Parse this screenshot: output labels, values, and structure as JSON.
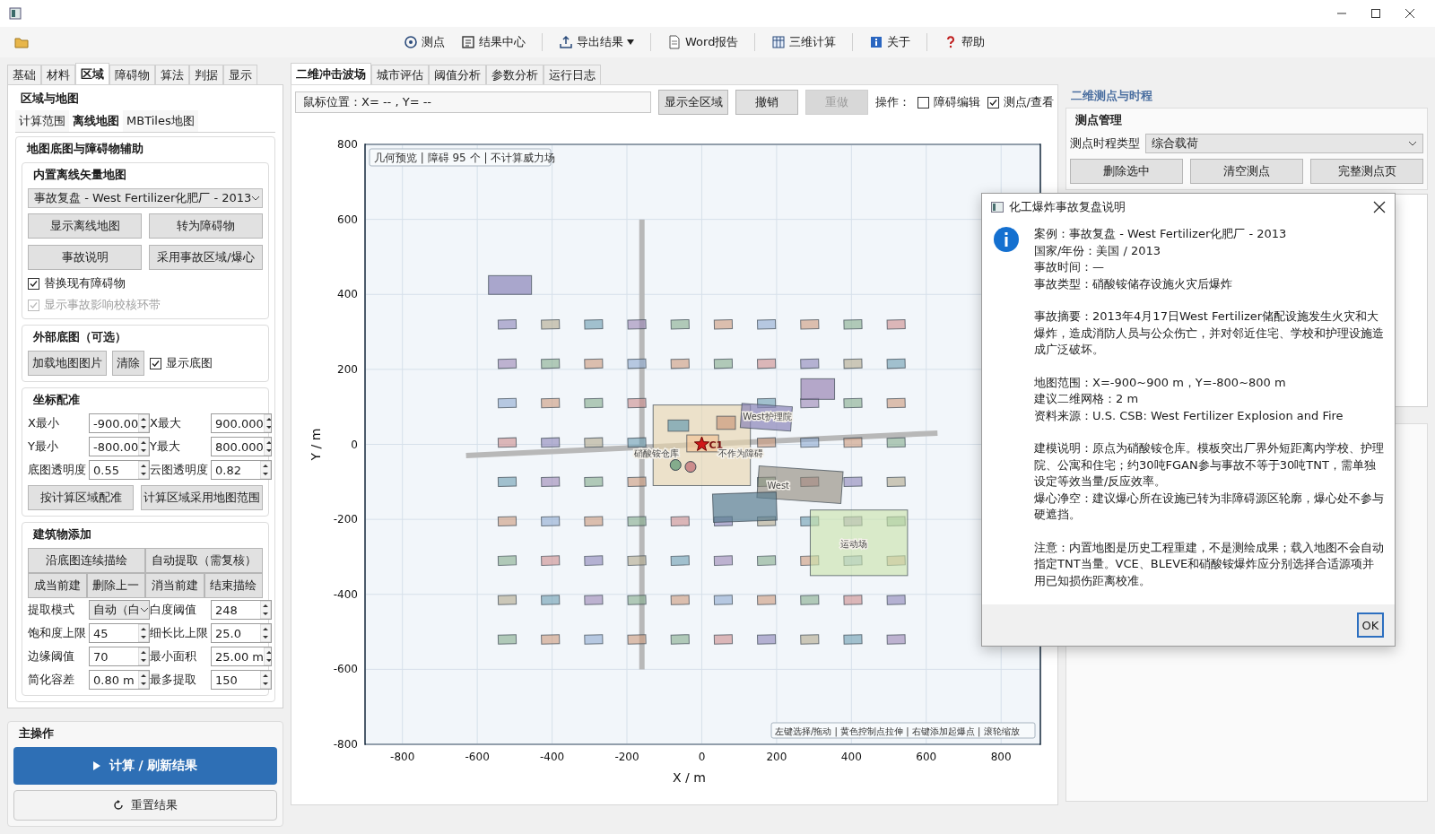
{
  "toolbar": [
    {
      "kind": "probe",
      "label": "测点",
      "menu": false
    },
    {
      "kind": "results",
      "label": "结果中心",
      "menu": false
    },
    {
      "kind": "export",
      "label": "导出结果",
      "menu": true
    },
    {
      "kind": "document",
      "label": "Word报告",
      "menu": false
    },
    {
      "kind": "grid3d",
      "label": "三维计算",
      "menu": false
    },
    {
      "kind": "about",
      "label": "关于",
      "menu": false
    },
    {
      "kind": "help",
      "label": "帮助",
      "menu": false
    }
  ],
  "left_tabs": [
    {
      "label": "基础",
      "selected": false
    },
    {
      "label": "材料",
      "selected": false
    },
    {
      "label": "区域",
      "selected": true
    },
    {
      "label": "障碍物",
      "selected": false
    },
    {
      "label": "算法",
      "selected": false
    },
    {
      "label": "判据",
      "selected": false
    },
    {
      "label": "显示",
      "selected": false
    }
  ],
  "region": {
    "title": "区域与地图",
    "tabs": [
      {
        "label": "计算范围",
        "selected": false
      },
      {
        "label": "离线地图",
        "selected": true
      },
      {
        "label": "MBTiles地图",
        "selected": false
      }
    ],
    "group_title": "地图底图与障碍物辅助",
    "offline_map": {
      "title": "内置离线矢量地图",
      "combo": "事故复盘 - West Fertilizer化肥厂 - 2013",
      "buttons": [
        "显示离线地图",
        "转为障碍物",
        "事故说明",
        "采用事故区域/爆心"
      ],
      "checks": [
        {
          "label": "替换现有障碍物",
          "checked": true,
          "disabled": false
        },
        {
          "label": "显示事故影响校核环带",
          "checked": true,
          "disabled": true
        }
      ]
    },
    "external": {
      "title": "外部底图（可选）",
      "buttons": [
        "加载地图图片",
        "清除"
      ],
      "check": {
        "label": "显示底图",
        "checked": true,
        "disabled": false
      }
    },
    "calibration": {
      "title": "坐标配准",
      "fields": [
        {
          "label": "X最小",
          "value": "-900.00"
        },
        {
          "label": "X最大",
          "value": "900.000"
        },
        {
          "label": "Y最小",
          "value": "-800.00"
        },
        {
          "label": "Y最大",
          "value": "800.000"
        },
        {
          "label": "底图透明度",
          "value": "0.55"
        },
        {
          "label": "云图透明度",
          "value": "0.82"
        }
      ],
      "buttons": [
        "按计算区域配准",
        "计算区域采用地图范围"
      ]
    },
    "buildings": {
      "title": "建筑物添加",
      "wide_buttons": [
        "沿底图连续描绘",
        "自动提取（需复核）"
      ],
      "small_buttons": [
        "成当前建",
        "删除上一",
        "消当前建",
        "结束描绘"
      ],
      "fields": [
        {
          "kind": "combo",
          "label": "提取模式",
          "value": "自动（白"
        },
        {
          "kind": "spin",
          "label": "白度阈值",
          "value": "248"
        },
        {
          "kind": "spin",
          "label": "饱和度上限",
          "value": "45"
        },
        {
          "kind": "spin",
          "label": "细长比上限",
          "value": "25.0"
        },
        {
          "kind": "spin",
          "label": "边缘阈值",
          "value": "70"
        },
        {
          "kind": "spin",
          "label": "最小面积",
          "value": "25.00 m"
        },
        {
          "kind": "spin",
          "label": "简化容差",
          "value": "0.80 m"
        },
        {
          "kind": "spin",
          "label": "最多提取",
          "value": "150"
        }
      ]
    }
  },
  "main_ops": {
    "title": "主操作",
    "primary": "计算 / 刷新结果",
    "secondary": "重置结果"
  },
  "center_tabs": [
    {
      "label": "二维冲击波场",
      "selected": true
    },
    {
      "label": "城市评估",
      "selected": false
    },
    {
      "label": "阈值分析",
      "selected": false
    },
    {
      "label": "参数分析",
      "selected": false
    },
    {
      "label": "运行日志",
      "selected": false
    }
  ],
  "plot_toolbar": {
    "mouse": "鼠标位置：X= -- , Y= --",
    "buttons": [
      {
        "label": "显示全区域",
        "disabled": false
      },
      {
        "label": "撤销",
        "disabled": false
      },
      {
        "label": "重做",
        "disabled": true
      }
    ],
    "ops_label": "操作：",
    "checks": [
      {
        "label": "障碍编辑",
        "checked": false
      },
      {
        "label": "测点/查看",
        "checked": true
      }
    ]
  },
  "plot": {
    "xlabel": "X / m",
    "ylabel": "Y / m",
    "x_ticks": [
      "-800",
      "-600",
      "-400",
      "-200",
      "0",
      "200",
      "400",
      "600",
      "800"
    ],
    "y_ticks": [
      "800",
      "600",
      "400",
      "200",
      "0",
      "-200",
      "-400",
      "-600",
      "-800"
    ],
    "info": "几何预览 | 障碍 95 个 | 不计算威力场",
    "hint": "左键选择/拖动 | 黄色控制点拉伸 | 右键添加起爆点 | 滚轮缩放",
    "origin_label": "C1",
    "site_labels": [
      "硝酸铵仓库",
      "不作为障碍",
      "West护理院",
      "West",
      "运动场"
    ]
  },
  "right": {
    "title": "二维测点与时程",
    "group_title": "测点管理",
    "type_label": "测点时程类型",
    "type_value": "综合载荷",
    "buttons": [
      "删除选中",
      "清空测点",
      "完整测点页"
    ]
  },
  "dialog": {
    "title": "化工爆炸事故复盘说明",
    "blocks": [
      [
        "案例：事故复盘 - West Fertilizer化肥厂 - 2013",
        "国家/年份：美国 / 2013",
        "事故时间：—",
        "事故类型：硝酸铵储存设施火灾后爆炸"
      ],
      [
        "事故摘要：2013年4月17日West Fertilizer储配设施发生火灾和大爆炸，造成消防人员与公众伤亡，并对邻近住宅、学校和护理设施造成广泛破坏。"
      ],
      [
        "地图范围：X=-900~900 m，Y=-800~800 m",
        "建议二维网格：2 m",
        "资料来源：U.S. CSB: West Fertilizer Explosion and Fire"
      ],
      [
        "建模说明：原点为硝酸铵仓库。模板突出厂界外短距离内学校、护理院、公寓和住宅；约30吨FGAN参与事故不等于30吨TNT，需单独设定等效当量/反应效率。",
        "爆心净空：建议爆心所在设施已转为非障碍源区轮廓，爆心处不参与硬遮挡。"
      ],
      [
        "注意：内置地图是历史工程重建，不是测绘成果；载入地图不会自动指定TNT当量。VCE、BLEVE和硝酸铵爆炸应分别选择合适源项并用已知损伤距离校准。"
      ]
    ],
    "button": "OK"
  }
}
